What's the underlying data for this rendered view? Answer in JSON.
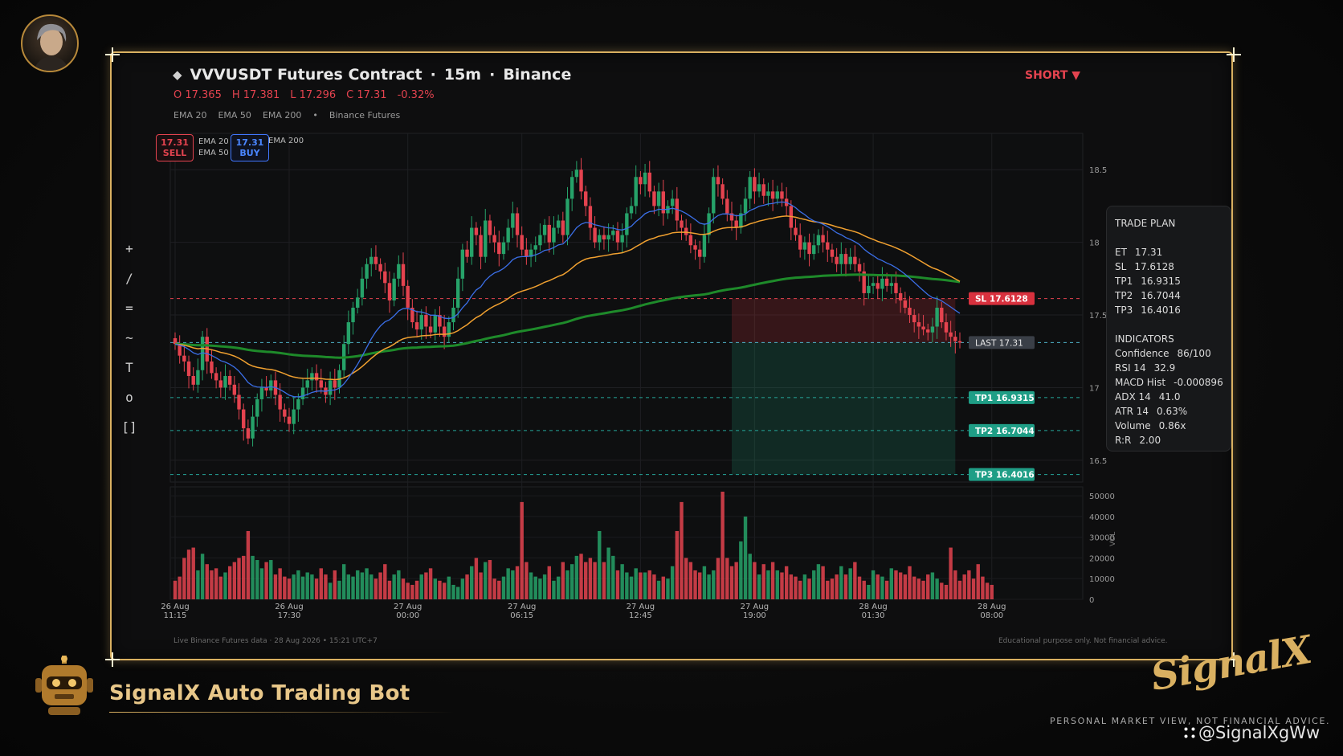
{
  "header": {
    "symbol": "VVVUSDT Futures Contract",
    "interval": "15m",
    "exchange": "Binance",
    "separator": "·",
    "ohlc": {
      "open": "O 17.365",
      "high": "H 17.381",
      "low": "L 17.296",
      "close": "C 17.31",
      "change": "-0.32%"
    },
    "indicators": [
      "EMA 20",
      "EMA 50",
      "EMA 200"
    ],
    "bullet": "•",
    "source": "Binance Futures",
    "direction": "SHORT ▼"
  },
  "toolbar": {
    "tools": [
      "+",
      "/",
      "=",
      "~",
      "T",
      "o",
      "[]"
    ]
  },
  "badges": {
    "sell_price": "17.31",
    "sell_label": "SELL",
    "buy_price": "17.31",
    "buy_label": "BUY",
    "legend_a": "EMA 20",
    "legend_b": "EMA 50",
    "legend_c": "EMA 200"
  },
  "trade_plan": {
    "title": "TRADE PLAN",
    "levels": [
      {
        "key": "ET",
        "value": "17.31"
      },
      {
        "key": "SL",
        "value": "17.6128"
      },
      {
        "key": "TP1",
        "value": "16.9315"
      },
      {
        "key": "TP2",
        "value": "16.7044"
      },
      {
        "key": "TP3",
        "value": "16.4016"
      }
    ],
    "ind_title": "INDICATORS",
    "indicators": [
      {
        "key": "Confidence",
        "value": "86/100"
      },
      {
        "key": "RSI 14",
        "value": "32.9"
      },
      {
        "key": "MACD Hist",
        "value": "-0.000896"
      },
      {
        "key": "ADX 14",
        "value": "41.0"
      },
      {
        "key": "ATR 14",
        "value": "0.63%"
      },
      {
        "key": "Volume",
        "value": "0.86x"
      },
      {
        "key": "R:R",
        "value": "2.00"
      }
    ]
  },
  "footer": {
    "left": "Live Binance Futures data  ·  28 Aug 2026 • 15:21 UTC+7",
    "right": "Educational purpose only. Not financial advice."
  },
  "brand": {
    "name": "SignalX Auto Trading Bot",
    "logo": "SignalX",
    "tagline": "PERSONAL MARKET VIEW, NOT FINANCIAL ADVICE.",
    "handle": "@SignalXgWw"
  },
  "colors": {
    "bull": "#26a269",
    "bear": "#e4434f",
    "ema20": "#3b6fe8",
    "ema50": "#f0a030",
    "ema200": "#1e8a2a",
    "gold": "#d9b061"
  },
  "chart_data": {
    "type": "candlestick",
    "price_axis": {
      "min": 16.35,
      "max": 18.75,
      "ticks": [
        16.5,
        17,
        17.5,
        18,
        18.5
      ]
    },
    "volume_axis": {
      "min": 0,
      "max": 52000,
      "ticks": [
        0,
        10000,
        20000,
        30000,
        40000,
        50000
      ],
      "label": "VOL"
    },
    "x_ticks": [
      {
        "line1": "26 Aug",
        "line2": "11:15",
        "index": 0
      },
      {
        "line1": "26 Aug",
        "line2": "17:30",
        "index": 25
      },
      {
        "line1": "27 Aug",
        "line2": "00:00",
        "index": 51
      },
      {
        "line1": "27 Aug",
        "line2": "06:15",
        "index": 76
      },
      {
        "line1": "27 Aug",
        "line2": "12:45",
        "index": 102
      },
      {
        "line1": "27 Aug",
        "line2": "19:00",
        "index": 127
      },
      {
        "line1": "28 Aug",
        "line2": "01:30",
        "index": 153
      },
      {
        "line1": "28 Aug",
        "line2": "08:00",
        "index": 179
      }
    ],
    "levels": {
      "sl": {
        "label": "SL",
        "value": 17.6128,
        "text": "17.6128"
      },
      "last": {
        "label": "LAST",
        "value": 17.31,
        "text": "17.31"
      },
      "tp1": {
        "label": "TP1",
        "value": 16.9315,
        "text": "16.9315"
      },
      "tp2": {
        "label": "TP2",
        "value": 16.7044,
        "text": "16.7044"
      },
      "tp3": {
        "label": "TP3",
        "value": 16.4016,
        "text": "16.4016"
      }
    },
    "trade_zone": {
      "start_index": 122,
      "end_index": 171
    },
    "closes": [
      17.3,
      17.22,
      17.18,
      17.08,
      17.02,
      17.12,
      17.35,
      17.18,
      17.1,
      17.05,
      17.0,
      17.08,
      17.02,
      16.95,
      16.85,
      16.72,
      16.65,
      16.8,
      16.92,
      17.0,
      16.98,
      17.05,
      16.95,
      16.85,
      16.8,
      16.75,
      16.85,
      16.92,
      17.0,
      17.05,
      17.1,
      17.05,
      17.0,
      16.95,
      17.05,
      17.0,
      17.12,
      17.3,
      17.45,
      17.55,
      17.62,
      17.75,
      17.85,
      17.9,
      17.85,
      17.8,
      17.72,
      17.6,
      17.75,
      17.85,
      17.7,
      17.55,
      17.45,
      17.4,
      17.5,
      17.42,
      17.38,
      17.5,
      17.42,
      17.35,
      17.45,
      17.55,
      17.75,
      17.95,
      17.9,
      18.1,
      18.05,
      17.9,
      18.15,
      18.05,
      18.0,
      17.92,
      18.0,
      18.1,
      18.2,
      18.05,
      17.95,
      17.9,
      17.95,
      17.98,
      18.05,
      18.12,
      18.0,
      18.1,
      18.15,
      18.05,
      18.3,
      18.45,
      18.5,
      18.35,
      18.25,
      18.1,
      18.0,
      18.05,
      18.02,
      18.05,
      18.08,
      18.0,
      18.05,
      18.2,
      18.25,
      18.45,
      18.4,
      18.48,
      18.35,
      18.25,
      18.35,
      18.2,
      18.25,
      18.3,
      18.15,
      18.1,
      18.05,
      17.98,
      17.95,
      17.9,
      18.05,
      18.2,
      18.45,
      18.4,
      18.3,
      18.2,
      18.15,
      18.1,
      18.2,
      18.3,
      18.45,
      18.35,
      18.4,
      18.32,
      18.35,
      18.3,
      18.35,
      18.3,
      18.25,
      18.1,
      18.05,
      17.95,
      18.0,
      17.92,
      17.98,
      18.05,
      18.0,
      17.95,
      17.9,
      17.85,
      17.92,
      17.85,
      17.9,
      17.85,
      17.8,
      17.65,
      17.7,
      17.72,
      17.68,
      17.75,
      17.7,
      17.72,
      17.65,
      17.6,
      17.55,
      17.5,
      17.45,
      17.42,
      17.4,
      17.38,
      17.42,
      17.55,
      17.45,
      17.38,
      17.35,
      17.32,
      17.31
    ],
    "volumes": [
      9000,
      11000,
      20000,
      24000,
      25000,
      14000,
      22000,
      17000,
      14000,
      15000,
      11000,
      13000,
      16000,
      18000,
      20000,
      21000,
      33000,
      21000,
      19000,
      15000,
      18000,
      19000,
      12000,
      15000,
      11000,
      10000,
      12000,
      14000,
      11000,
      13000,
      12000,
      10000,
      15000,
      12000,
      8000,
      14000,
      9000,
      17000,
      12000,
      11000,
      14000,
      13000,
      15000,
      12000,
      10000,
      13000,
      17000,
      9000,
      12000,
      14000,
      10000,
      8000,
      7000,
      9000,
      12000,
      13000,
      15000,
      10000,
      9000,
      8000,
      11000,
      7000,
      6000,
      10000,
      12000,
      16000,
      20000,
      13000,
      18000,
      19000,
      10000,
      9000,
      11000,
      15000,
      14000,
      16000,
      47000,
      18000,
      13000,
      11000,
      10000,
      12000,
      16000,
      9000,
      11000,
      18000,
      14000,
      17000,
      21000,
      22000,
      18000,
      20000,
      18000,
      33000,
      18000,
      25000,
      21000,
      14000,
      17000,
      13000,
      11000,
      15000,
      13000,
      13000,
      14000,
      12000,
      9000,
      11000,
      10000,
      16000,
      33000,
      47000,
      20000,
      18000,
      14000,
      13000,
      16000,
      12000,
      14000,
      20000,
      52000,
      20000,
      16000,
      18000,
      28000,
      40000,
      22000,
      18000,
      12000,
      17000,
      14000,
      18000,
      14000,
      13000,
      16000,
      12000,
      11000,
      9000,
      12000,
      10000,
      14000,
      17000,
      16000,
      9000,
      10000,
      12000,
      16000,
      12000,
      15000,
      18000,
      11000,
      9000,
      7000,
      14000,
      12000,
      11000,
      9000,
      15000,
      14000,
      13000,
      12000,
      16000,
      11000,
      10000,
      9000,
      12000,
      13000,
      10000,
      8000,
      7000,
      25000,
      14000,
      9000,
      12000,
      14000,
      10000,
      17000,
      11000,
      8000,
      7000
    ]
  }
}
